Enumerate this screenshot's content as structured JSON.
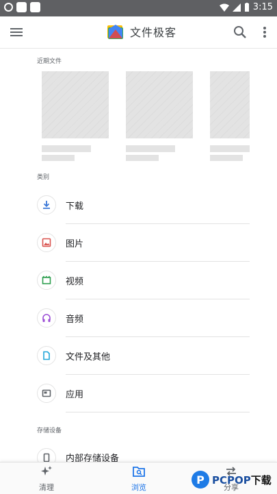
{
  "status_bar": {
    "time": "3:15"
  },
  "app_bar": {
    "title": "文件极客"
  },
  "sections": {
    "recent": "近期文件",
    "categories": "类别",
    "storage": "存储设备"
  },
  "categories": [
    {
      "label": "下载",
      "icon": "download-icon",
      "color": "#3b78d8"
    },
    {
      "label": "图片",
      "icon": "image-icon",
      "color": "#d9534f"
    },
    {
      "label": "视频",
      "icon": "video-icon",
      "color": "#2e9e4f"
    },
    {
      "label": "音频",
      "icon": "headphones-icon",
      "color": "#9c4fd6"
    },
    {
      "label": "文件及其他",
      "icon": "document-icon",
      "color": "#1fa6d9"
    },
    {
      "label": "应用",
      "icon": "app-icon",
      "color": "#5f6368"
    }
  ],
  "storage": [
    {
      "label": "内部存储设备",
      "icon": "phone-storage-icon"
    }
  ],
  "bottom_nav": [
    {
      "label": "清理",
      "icon": "sparkle-icon",
      "active": false
    },
    {
      "label": "浏览",
      "icon": "browse-icon",
      "active": true
    },
    {
      "label": "分享",
      "icon": "share-icon",
      "active": false
    }
  ],
  "colors": {
    "accent": "#1a73e8",
    "status_bar": "#5f6063"
  },
  "watermark": {
    "brand": "PCPOP",
    "suffix": "下载"
  }
}
